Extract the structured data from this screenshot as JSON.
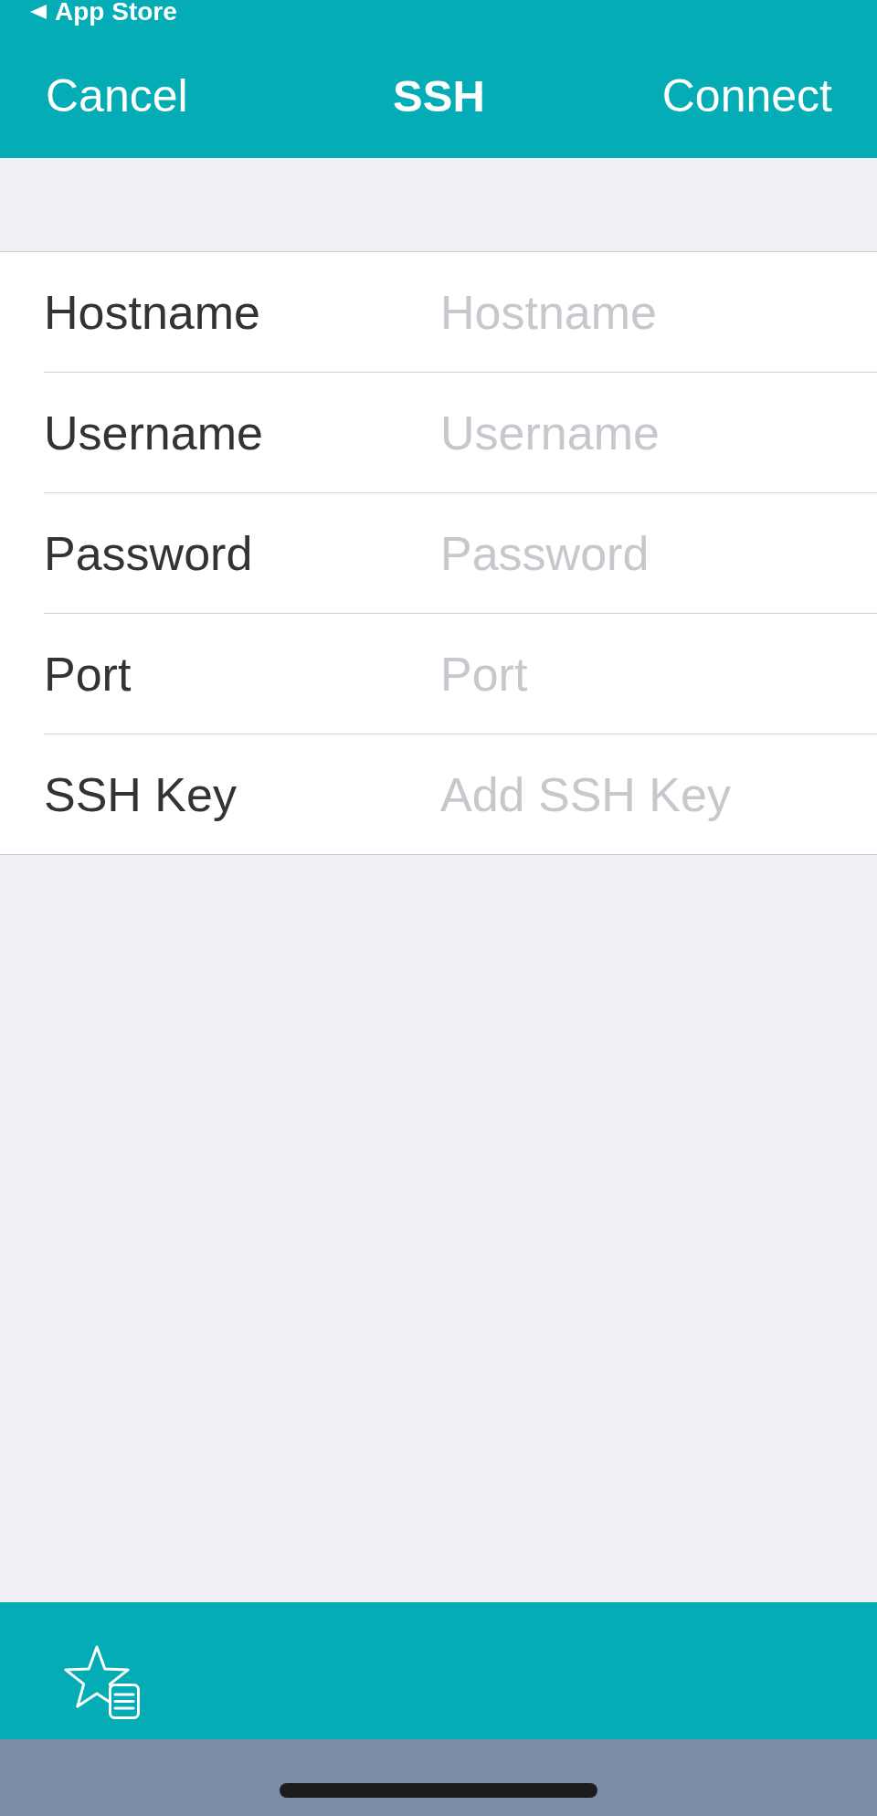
{
  "status_bar": {
    "back_label": "App Store"
  },
  "navigation_bar": {
    "cancel_button": "Cancel",
    "title": "SSH",
    "connect_button": "Connect"
  },
  "form": {
    "rows": [
      {
        "label": "Hostname",
        "placeholder": "Hostname"
      },
      {
        "label": "Username",
        "placeholder": "Username"
      },
      {
        "label": "Password",
        "placeholder": "Password"
      },
      {
        "label": "Port",
        "placeholder": "Port"
      },
      {
        "label": "SSH Key",
        "placeholder": "Add SSH Key"
      }
    ]
  }
}
